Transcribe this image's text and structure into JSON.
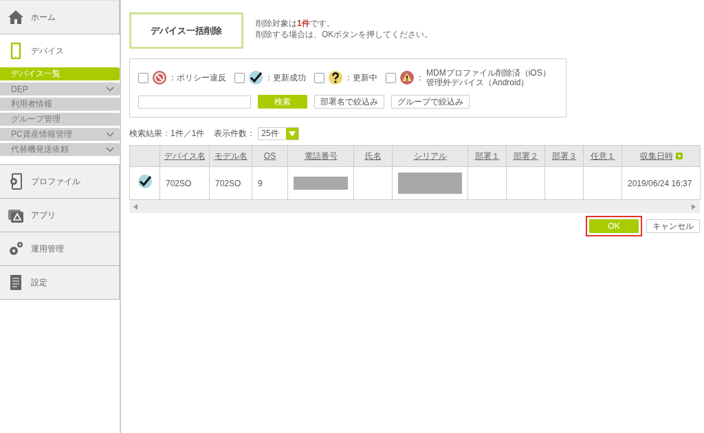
{
  "sidebar": {
    "items": [
      {
        "kind": "home",
        "label": "ホーム",
        "expanded": false
      },
      {
        "kind": "device",
        "label": "デバイス",
        "expanded": true,
        "children": [
          {
            "label": "デバイス一覧",
            "selected": true,
            "caret": false
          },
          {
            "label": "DEP",
            "selected": false,
            "caret": true
          },
          {
            "label": "利用者情報",
            "selected": false,
            "caret": false
          },
          {
            "label": "グループ管理",
            "selected": false,
            "caret": false
          },
          {
            "label": "PC資産情報管理",
            "selected": false,
            "caret": true
          },
          {
            "label": "代替機発送依頼",
            "selected": false,
            "caret": true
          }
        ]
      },
      {
        "kind": "profile",
        "label": "プロファイル",
        "expanded": false
      },
      {
        "kind": "app",
        "label": "アプリ",
        "expanded": false
      },
      {
        "kind": "gears",
        "label": "運用管理",
        "expanded": false
      },
      {
        "kind": "document",
        "label": "設定",
        "expanded": false
      }
    ]
  },
  "page_title": "デバイス一括削除",
  "message": [
    "削除対象は**1件**です。",
    "削除する場合は、OKボタンを押してください。"
  ],
  "filters": {
    "statuses": [
      {
        "kind": "violation",
        "label": "：ポリシー違反",
        "checked": false
      },
      {
        "kind": "success",
        "label": "：更新成功",
        "checked": false
      },
      {
        "kind": "updating",
        "label": "：更新中",
        "checked": false
      },
      {
        "kind": "removed",
        "separator": "：",
        "label": "MDMプロファイル削除済（iOS）",
        "sublabel": "管理外デバイス（Android）",
        "checked": false
      }
    ],
    "search_button": "検索",
    "dept_button": "部署名で絞込み",
    "group_button": "グループで絞込み"
  },
  "result_label": "検索結果：1件／1件",
  "per_page_label": "表示件数：",
  "per_page": "25件",
  "table": {
    "columns": [
      {
        "kind": "check"
      },
      {
        "kind": "text",
        "label": "デバイス名",
        "sorted": false
      },
      {
        "kind": "text",
        "label": "モデル名",
        "sorted": false
      },
      {
        "kind": "text",
        "label": "OS",
        "sorted": false
      },
      {
        "kind": "text",
        "label": "電話番号",
        "sorted": false
      },
      {
        "kind": "text",
        "label": "氏名",
        "sorted": false
      },
      {
        "kind": "text",
        "label": "シリアル",
        "sorted": false
      },
      {
        "kind": "text",
        "label": "部署１",
        "sorted": false
      },
      {
        "kind": "text",
        "label": "部署２",
        "sorted": false
      },
      {
        "kind": "text",
        "label": "部署３",
        "sorted": false
      },
      {
        "kind": "text",
        "label": "任意１",
        "sorted": false
      },
      {
        "kind": "text",
        "label": "収集日時",
        "sorted": true
      }
    ],
    "rows": [
      {
        "cells": [
          {
            "kind": "success"
          },
          {
            "kind": "text",
            "text": "702SO"
          },
          {
            "kind": "text",
            "text": "702SO"
          },
          {
            "kind": "text",
            "text": "9"
          },
          {
            "kind": "redacted"
          },
          {
            "kind": "empty"
          },
          {
            "kind": "redacted"
          },
          {
            "kind": "empty"
          },
          {
            "kind": "empty"
          },
          {
            "kind": "empty"
          },
          {
            "kind": "empty"
          },
          {
            "kind": "text",
            "text": "2019/06/24 16:37"
          }
        ]
      }
    ]
  },
  "ok_button": {
    "label": "OK",
    "highlighted": true
  },
  "cancel_button": "キャンセル"
}
